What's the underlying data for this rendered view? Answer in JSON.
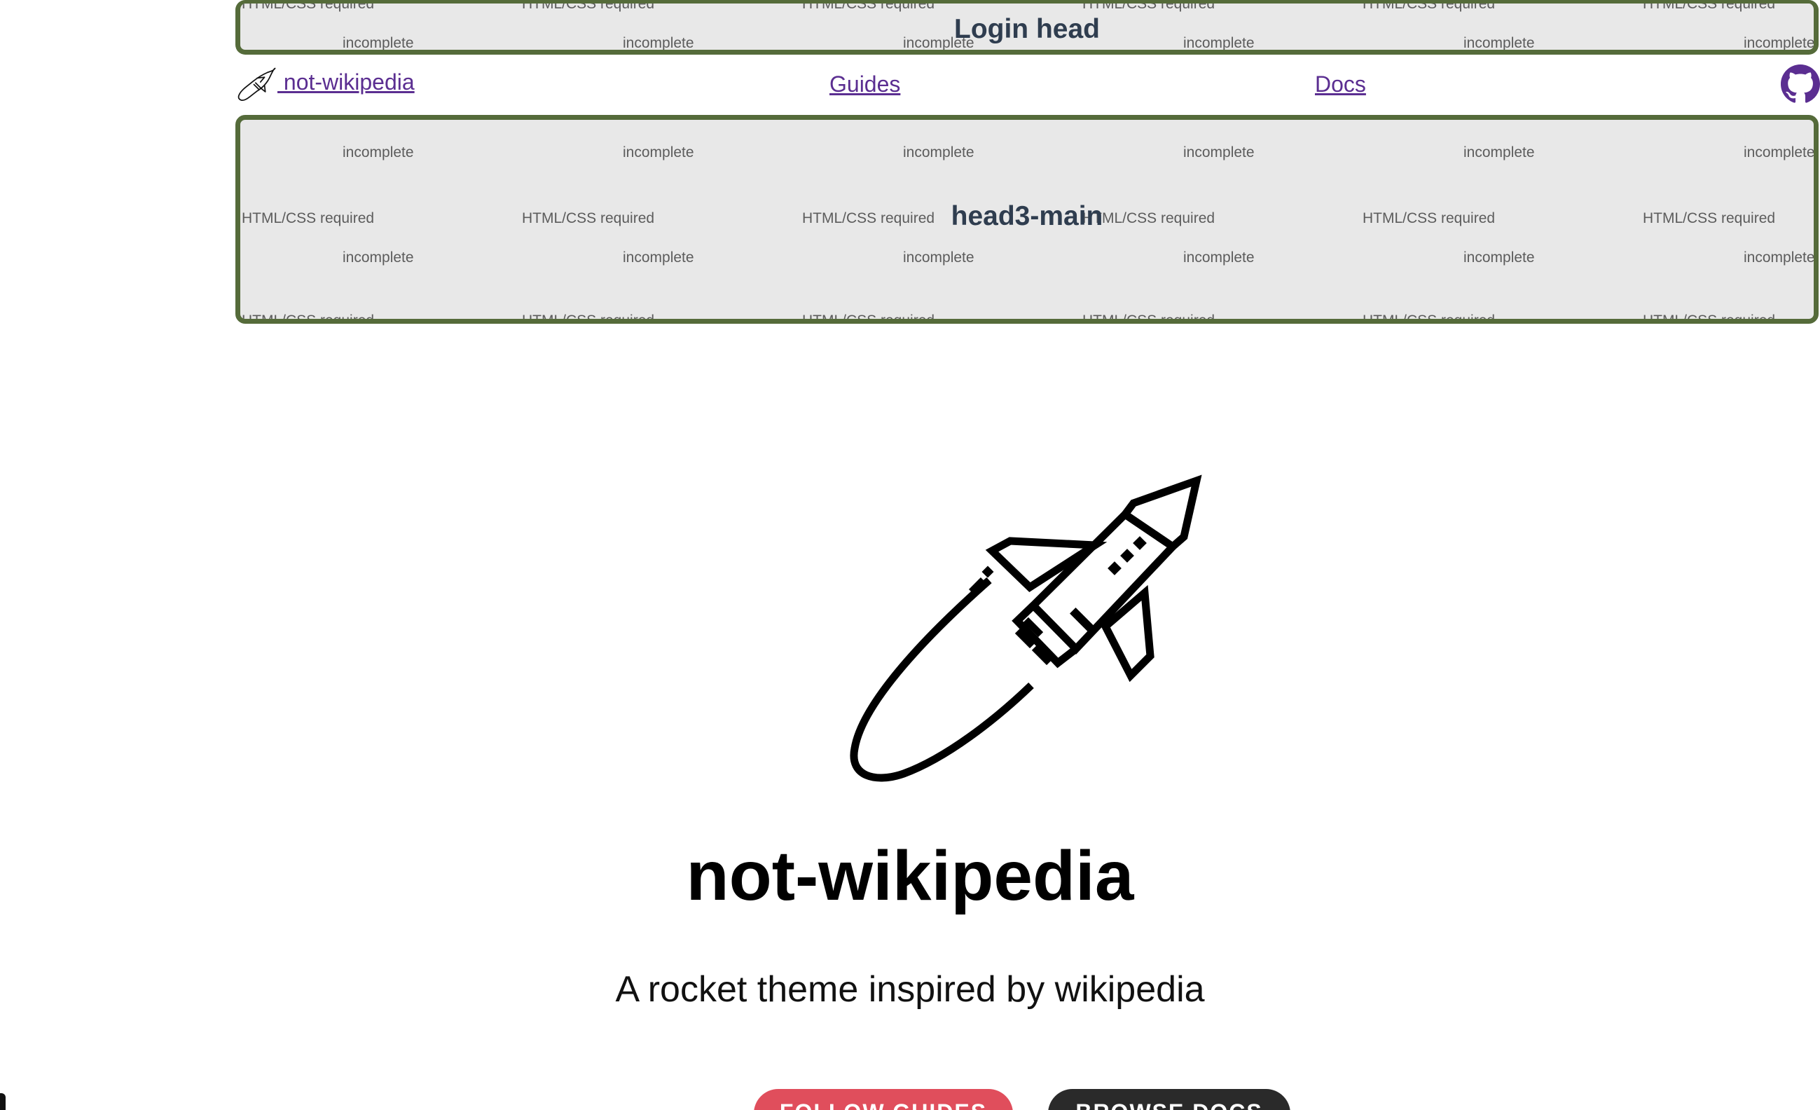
{
  "placeholders": {
    "login_head": {
      "title": "Login head",
      "watermark_required": "HTML/CSS required",
      "watermark_incomplete": "incomplete"
    },
    "head3_main": {
      "title": "head3-main",
      "watermark_required": "HTML/CSS required",
      "watermark_incomplete": "incomplete"
    }
  },
  "nav": {
    "brand_label": " not-wikipedia",
    "guides_label": "Guides",
    "docs_label": "Docs",
    "brand_icon": "rocket-icon",
    "github_icon": "github-icon"
  },
  "hero": {
    "icon": "rocket-icon",
    "title": "not-wikipedia",
    "subtitle": "A rocket theme inspired by wikipedia",
    "primary_button": "FOLLOW GUIDES",
    "secondary_button": "BROWSE DOCS"
  },
  "colors": {
    "link": "#5b2e91",
    "panel_border": "#556b3a",
    "panel_bg": "#e8e8e8",
    "primary_button": "#e04e5c",
    "secondary_button": "#2a2a2a"
  }
}
